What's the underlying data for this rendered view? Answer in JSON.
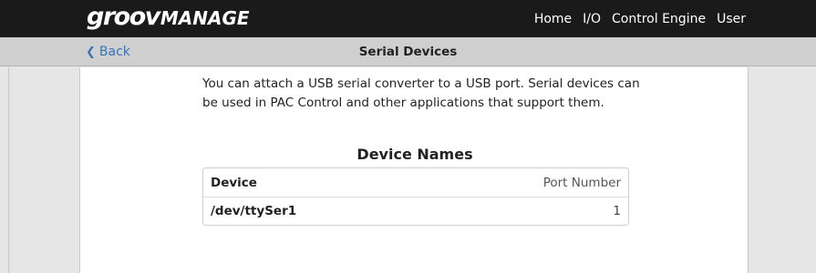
{
  "header": {
    "brand_groov": "groov",
    "brand_manage": "MANAGE",
    "nav": [
      "Home",
      "I/O",
      "Control Engine",
      "User"
    ]
  },
  "subheader": {
    "back_label": "Back",
    "title": "Serial Devices"
  },
  "main": {
    "description": "You can attach a USB serial converter to a USB port. Serial devices can be used in PAC Control and other applications that support them.",
    "section_title": "Device Names",
    "table": {
      "columns": [
        "Device",
        "Port Number"
      ],
      "rows": [
        {
          "device": "/dev/ttySer1",
          "port": "1"
        }
      ]
    }
  },
  "colors": {
    "topbar": "#1a1a1a",
    "link": "#3a73b5",
    "subbar": "#cfcfcf"
  }
}
